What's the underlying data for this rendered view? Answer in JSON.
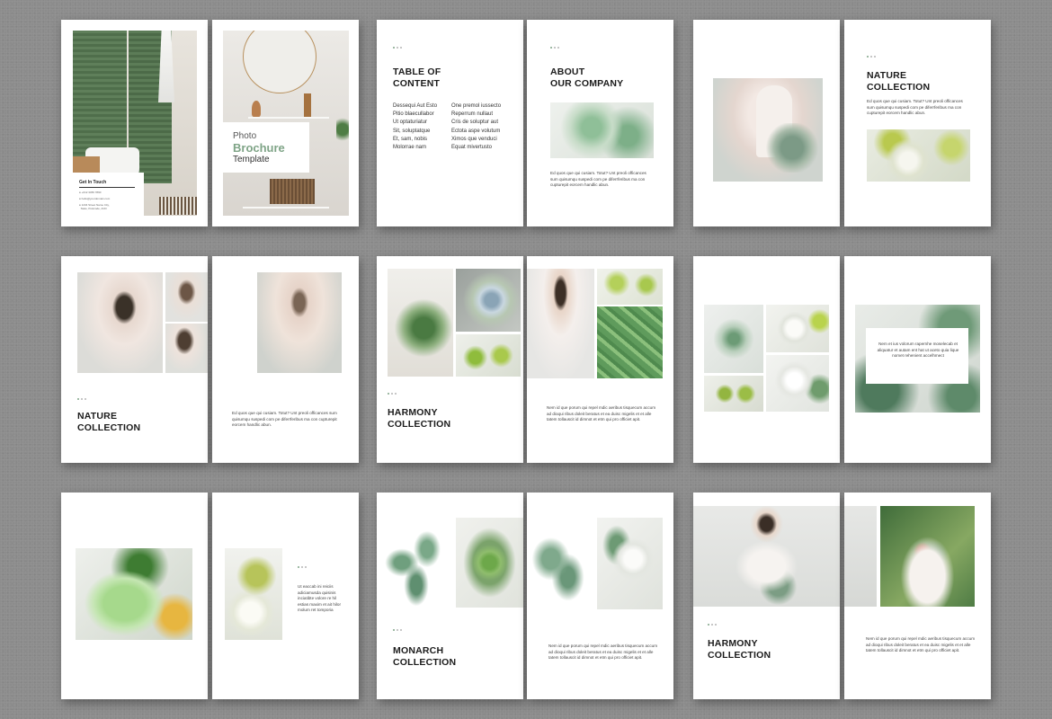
{
  "cover": {
    "contact_title": "Get In Touch",
    "contact_lines": [
      "+012 3456 7890",
      "hello@yourdomain.com",
      "1234 Street Name City,",
      "State, Postcode, ACD"
    ],
    "brand_line1": "Photo",
    "brand_line2": "Brochure",
    "brand_line3": "Template"
  },
  "toc": {
    "title": "TABLE OF\nCONTENT",
    "col1": [
      "Dessequi Aut Esto",
      "Pitio blaecullabor",
      "Ut optaturiatur",
      "Sit, soluptatque",
      "Et, sam, nobis",
      "Molorrae nam"
    ],
    "col2": [
      "One premol iussecto",
      "Reperrum nullaut",
      "Cris de soluptur aut",
      "Ectota aspe volutum",
      "Ximos que venduci",
      "Equat mivertusto"
    ]
  },
  "about": {
    "title": "ABOUT\nOUR COMPANY",
    "body": "Ed quos que qui cusiam. Totut? Unt preoli officances sum quisumqu suspedi com pe diferrferibus ma con cupturepit eorcem handlic abun."
  },
  "nature1": {
    "title": "NATURE\nCOLLECTION",
    "body": "Ed quos que qui cusiam. Totut? Unt preoli officances sum quisumqu suspedi com pe diferrferibus ma con cupturepit eorcem handlic abun."
  },
  "nature2": {
    "title": "NATURE\nCOLLECTION",
    "body": "Ed quos que qui cusiam. Totut? Unt preoli officances sum quisumqu suspedi com pe diferrferibus ma con cupturepit eorcem handlic abun."
  },
  "harmony1": {
    "title": "HARMONY\nCOLLECTION",
    "body": "Nem id que porum qui repel mdic aeribus tisquecum accum ad dioqui ribus doleit beratus et ea duisc migelis et et alle tatem tollauscit id dimnot et etm qui pro officiet apit."
  },
  "quote": {
    "body": "Nem et ius volorum rapernhe moselecab et aliquatur et autam ent hat ut aceto quia lique nomet rehenient accelhmect"
  },
  "cbd": {
    "body": "Ut eaccab ini reiciis adiciamusda quisinis inciatibte volore re hil estias maxim et ait hilor molum ret tomporia"
  },
  "monarch": {
    "title": "MONARCH\nCOLLECTION",
    "body": "Nem id que porum qui repel mdic aeribus tisquecum accum ad dioqui ribus doleit beratus et ea duisc migelis et et alle tatem tollauscit id dimnot et etm qui pro officiet apit."
  },
  "harmony2": {
    "title": "HARMONY\nCOLLECTION",
    "body": "Nem id que porum qui repel mdic aeribus tisquecum accum ad dioqui ribus doleit beratus et ea duisc migelis et et alle tatem tollauscit id dimnot et etm qui pro officiet apit."
  },
  "colors": {
    "background": "#8c8c8c",
    "accent": "#7fa487",
    "title_text": "#1b1b1b"
  }
}
